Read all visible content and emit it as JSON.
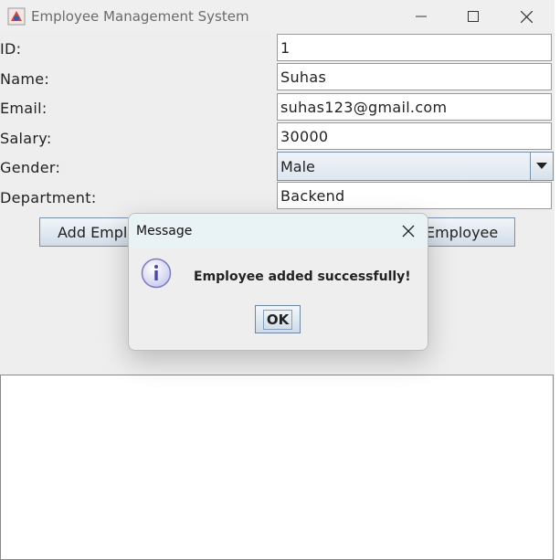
{
  "window": {
    "title": "Employee Management System"
  },
  "form": {
    "id_label": "ID:",
    "id_value": "1",
    "name_label": "Name:",
    "name_value": "Suhas",
    "email_label": "Email:",
    "email_value": "suhas123@gmail.com",
    "salary_label": "Salary:",
    "salary_value": "30000",
    "gender_label": "Gender:",
    "gender_value": "Male",
    "department_label": "Department:",
    "department_value": "Backend"
  },
  "buttons": {
    "add_label": "Add Employee",
    "right_label": "Employee"
  },
  "dialog": {
    "title": "Message",
    "message": "Employee added successfully!",
    "ok_label": "OK",
    "icon": "info-icon"
  },
  "colors": {
    "window_bg": "#eeeeee",
    "dialog_title_bg": "#e9f2f4",
    "button_border": "#7a8fa8"
  }
}
